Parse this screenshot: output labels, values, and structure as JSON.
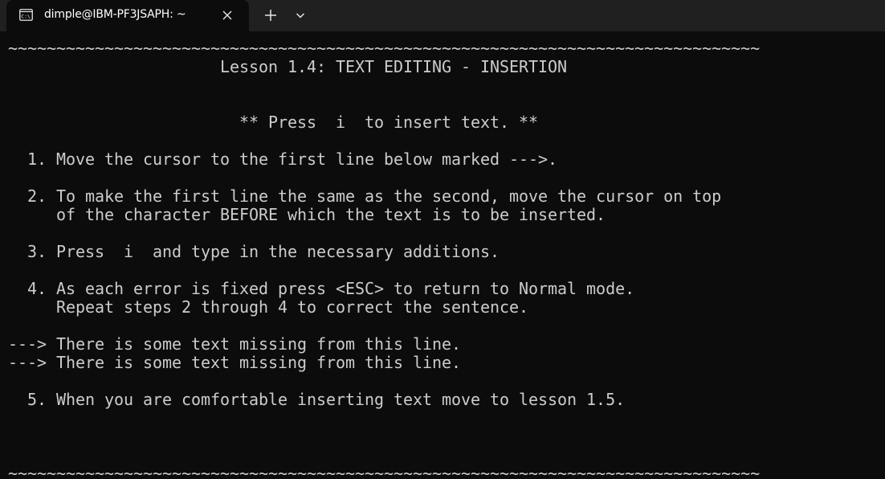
{
  "window": {
    "tab_title": "dimple@IBM-PF3JSAPH: ~",
    "icons": {
      "tab": "terminal-icon",
      "close": "close-icon",
      "new_tab": "plus-icon",
      "dropdown": "chevron-down-icon"
    }
  },
  "terminal": {
    "border_top": "~~~~~~~~~~~~~~~~~~~~~~~~~~~~~~~~~~~~~~~~~~~~~~~~~~~~~~~~~~~~~~~~~~~~~~~~~~~~~~",
    "heading": "                      Lesson 1.4: TEXT EDITING - INSERTION",
    "tip": "                        ** Press  i  to insert text. **",
    "step1": "  1. Move the cursor to the first line below marked --->.",
    "step2_a": "  2. To make the first line the same as the second, move the cursor on top",
    "step2_b": "     of the character BEFORE which the text is to be inserted.",
    "step3": "  3. Press  i  and type in the necessary additions.",
    "step4_a": "  4. As each error is fixed press <ESC> to return to Normal mode.",
    "step4_b": "     Repeat steps 2 through 4 to correct the sentence.",
    "practice1": "---> There is some text missing from this line.",
    "practice2": "---> There is some text missing from this line.",
    "step5": "  5. When you are comfortable inserting text move to lesson 1.5.",
    "border_bottom": "~~~~~~~~~~~~~~~~~~~~~~~~~~~~~~~~~~~~~~~~~~~~~~~~~~~~~~~~~~~~~~~~~~~~~~~~~~~~~~"
  },
  "colors": {
    "terminal_bg": "#0c0c0c",
    "titlebar_bg": "#202020",
    "text": "#cccccc"
  }
}
